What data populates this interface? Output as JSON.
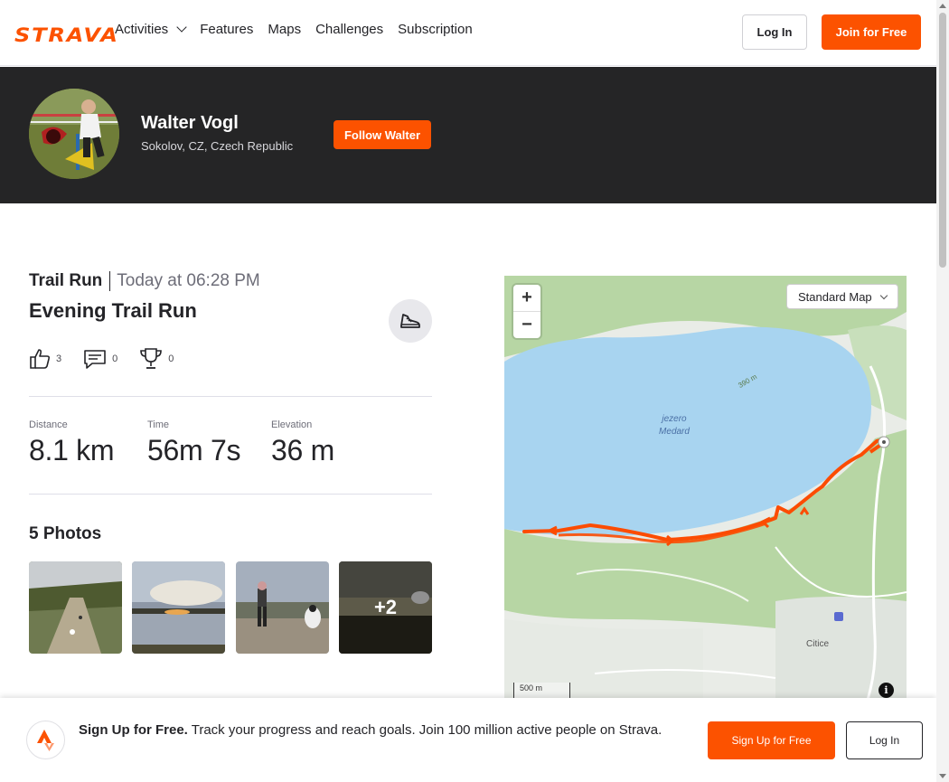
{
  "header": {
    "logo": "STRAVA",
    "nav": [
      {
        "label": "Activities",
        "dropdown": true
      },
      {
        "label": "Features"
      },
      {
        "label": "Maps"
      },
      {
        "label": "Challenges"
      },
      {
        "label": "Subscription"
      }
    ],
    "login_label": "Log In",
    "join_label": "Join for Free"
  },
  "athlete": {
    "name": "Walter Vogl",
    "location": "Sokolov, CZ, Czech Republic",
    "follow_label": "Follow Walter"
  },
  "activity": {
    "type": "Trail Run",
    "time": "Today at 06:28 PM",
    "title": "Evening Trail Run",
    "kudos": "3",
    "comments": "0",
    "achievements": "0",
    "stats": [
      {
        "label": "Distance",
        "value": "8.1 km"
      },
      {
        "label": "Time",
        "value": "56m 7s"
      },
      {
        "label": "Elevation",
        "value": "36 m"
      }
    ],
    "photos_title": "5 Photos",
    "more_photos": "+2"
  },
  "map": {
    "style_select": "Standard Map",
    "zoom_in": "+",
    "zoom_out": "−",
    "scale_label": "500 m",
    "lake_label": "jezero Medard",
    "contour_label": "390 m",
    "town_label": "Citice",
    "info": "i",
    "route_color": "#fc4c02",
    "water_color": "#a8d4f0"
  },
  "banner": {
    "bold": "Sign Up for Free.",
    "text": " Track your progress and reach goals. Join 100 million active people on Strava.",
    "signup_label": "Sign Up for Free",
    "login_label": "Log In"
  },
  "colors": {
    "brand": "#fc5200",
    "dark_band": "#252526"
  }
}
